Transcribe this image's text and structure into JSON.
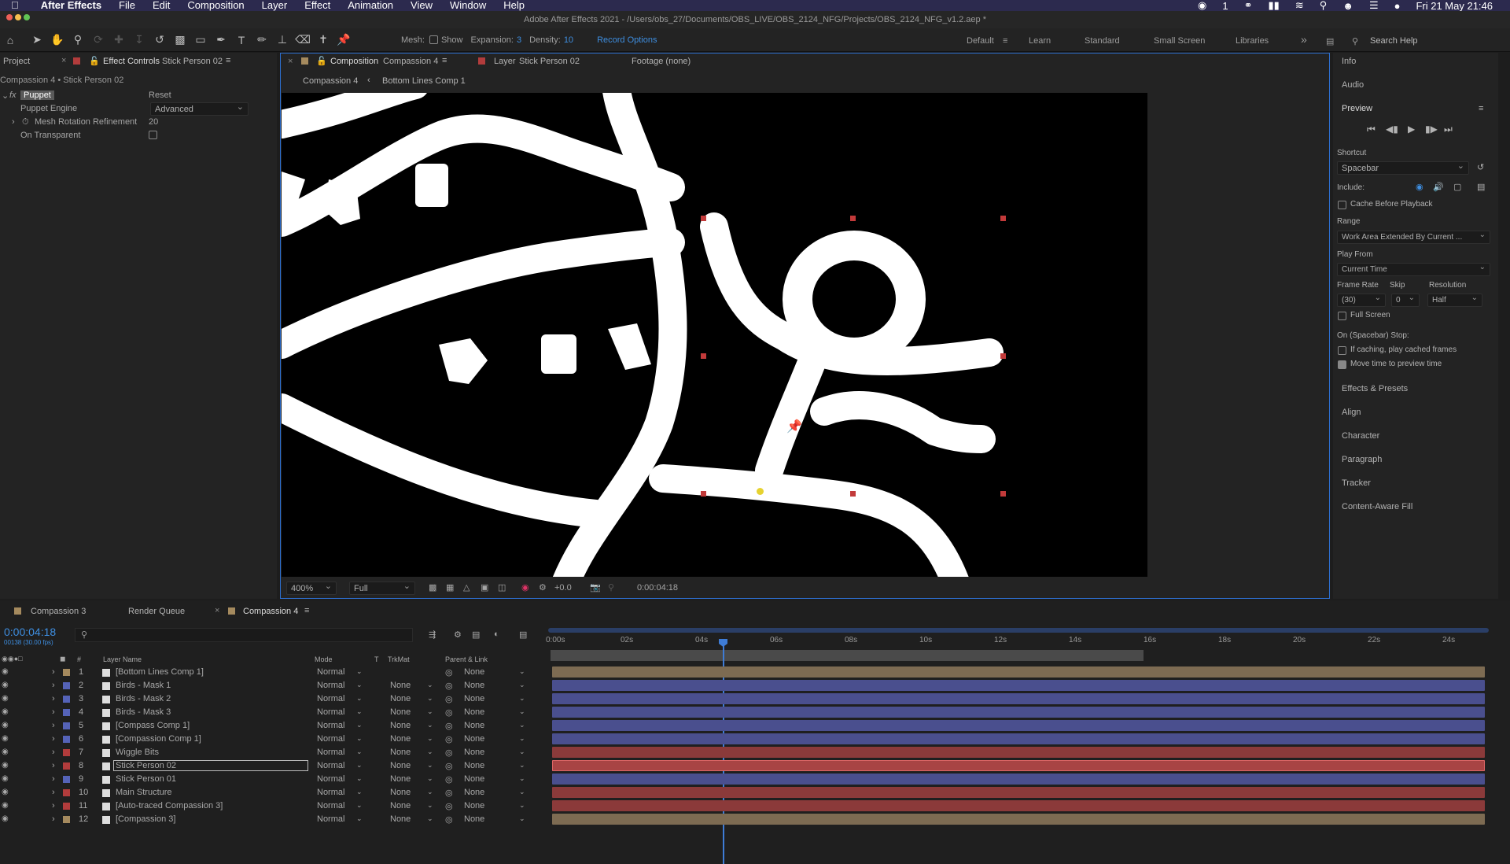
{
  "menubar": {
    "apple": "",
    "items": [
      "After Effects",
      "File",
      "Edit",
      "Composition",
      "Layer",
      "Effect",
      "Animation",
      "View",
      "Window",
      "Help"
    ],
    "clock": "Fri 21 May  21:46",
    "status_badge": "1"
  },
  "titlebar": {
    "title": "Adobe After Effects 2021 - /Users/obs_27/Documents/OBS_LIVE/OBS_2124_NFG/Projects/OBS_2124_NFG_v1.2.aep *"
  },
  "toolbar": {
    "mesh_label": "Mesh:",
    "show_label": "Show",
    "expansion_label": "Expansion:",
    "expansion_value": "3",
    "density_label": "Density:",
    "density_value": "10",
    "record_options": "Record Options",
    "workspaces": [
      "Default",
      "Learn",
      "Standard",
      "Small Screen",
      "Libraries"
    ],
    "search_placeholder": "Search Help"
  },
  "left_panel": {
    "tab_project": "Project",
    "tab_effect_controls": "Effect Controls",
    "tab_effect_layer": "Stick Person 02",
    "breadcrumb": "Compassion 4 • Stick Person 02",
    "effect_name": "Puppet",
    "fx_label": "fx",
    "reset_label": "Reset",
    "puppet_engine_label": "Puppet Engine",
    "puppet_engine_value": "Advanced",
    "mesh_rotation_label": "Mesh Rotation Refinement",
    "mesh_rotation_value": "20",
    "on_transparent_label": "On Transparent"
  },
  "viewer": {
    "tab_composition_label": "Composition",
    "tab_composition_name": "Compassion 4",
    "tab_layer_label": "Layer",
    "tab_layer_name": "Stick Person 02",
    "tab_footage": "Footage (none)",
    "crumb_1": "Compassion 4",
    "crumb_2": "Bottom Lines Comp 1",
    "zoom": "400%",
    "resolution": "Full",
    "exposure": "+0.0",
    "timecode": "0:00:04:18"
  },
  "right_panel": {
    "info": "Info",
    "audio": "Audio",
    "preview": "Preview",
    "shortcut_label": "Shortcut",
    "shortcut_value": "Spacebar",
    "include_label": "Include:",
    "cache_before_playback": "Cache Before Playback",
    "range_label": "Range",
    "range_value": "Work Area Extended By Current ...",
    "play_from_label": "Play From",
    "play_from_value": "Current Time",
    "frame_rate_label": "Frame Rate",
    "skip_label": "Skip",
    "resolution_label": "Resolution",
    "frame_rate_value": "(30)",
    "skip_value": "0",
    "resolution_value": "Half",
    "full_screen": "Full Screen",
    "on_stop_label": "On (Spacebar) Stop:",
    "if_caching": "If caching, play cached frames",
    "move_time": "Move time to preview time",
    "panels": [
      "Effects & Presets",
      "Align",
      "Character",
      "Paragraph",
      "Tracker",
      "Content-Aware Fill"
    ]
  },
  "timeline": {
    "tabs": [
      "Compassion 3",
      "Render Queue",
      "Compassion 4"
    ],
    "timecode": "0:00:04:18",
    "frame_info": "00138 (30.00 fps)",
    "col_layer_name": "Layer Name",
    "col_mode": "Mode",
    "col_t": "T",
    "col_trkmat": "TrkMat",
    "col_parent": "Parent & Link",
    "col_num": "#",
    "ruler": [
      "0:00s",
      "02s",
      "04s",
      "06s",
      "08s",
      "10s",
      "12s",
      "14s",
      "16s",
      "18s",
      "20s",
      "22s",
      "24s"
    ],
    "layers": [
      {
        "num": "1",
        "name": "[Bottom Lines Comp 1]",
        "mode": "Normal",
        "trkmat": "",
        "parent": "None",
        "color": "#a58a5e",
        "bar": "#7d6b52"
      },
      {
        "num": "2",
        "name": "Birds - Mask 1",
        "mode": "Normal",
        "trkmat": "None",
        "parent": "None",
        "color": "#5563b8",
        "bar": "#4a4f8e"
      },
      {
        "num": "3",
        "name": "Birds - Mask 2",
        "mode": "Normal",
        "trkmat": "None",
        "parent": "None",
        "color": "#5563b8",
        "bar": "#4a4f8e"
      },
      {
        "num": "4",
        "name": "Birds - Mask 3",
        "mode": "Normal",
        "trkmat": "None",
        "parent": "None",
        "color": "#5563b8",
        "bar": "#4a4f8e"
      },
      {
        "num": "5",
        "name": "[Compass Comp 1]",
        "mode": "Normal",
        "trkmat": "None",
        "parent": "None",
        "color": "#5563b8",
        "bar": "#4a4f8e"
      },
      {
        "num": "6",
        "name": "[Compassion Comp 1]",
        "mode": "Normal",
        "trkmat": "None",
        "parent": "None",
        "color": "#5563b8",
        "bar": "#4a4f8e"
      },
      {
        "num": "7",
        "name": "Wiggle Bits",
        "mode": "Normal",
        "trkmat": "None",
        "parent": "None",
        "color": "#b23c3c",
        "bar": "#8b3a3a"
      },
      {
        "num": "8",
        "name": "Stick Person 02",
        "mode": "Normal",
        "trkmat": "None",
        "parent": "None",
        "color": "#b23c3c",
        "bar": "#a84444"
      },
      {
        "num": "9",
        "name": "Stick Person 01",
        "mode": "Normal",
        "trkmat": "None",
        "parent": "None",
        "color": "#5563b8",
        "bar": "#4a4f8e"
      },
      {
        "num": "10",
        "name": "Main Structure",
        "mode": "Normal",
        "trkmat": "None",
        "parent": "None",
        "color": "#b23c3c",
        "bar": "#8b3a3a"
      },
      {
        "num": "11",
        "name": "[Auto-traced Compassion 3]",
        "mode": "Normal",
        "trkmat": "None",
        "parent": "None",
        "color": "#b23c3c",
        "bar": "#8b3a3a"
      },
      {
        "num": "12",
        "name": "[Compassion 3]",
        "mode": "Normal",
        "trkmat": "None",
        "parent": "None",
        "color": "#a58a5e",
        "bar": "#7d6b52"
      }
    ]
  },
  "colors": {
    "accent_blue": "#3e8ee0",
    "menubar": "#2c2a4e",
    "panel": "#232323",
    "puppet_pin": "#c23a3a",
    "active_pin": "#e6d230"
  }
}
